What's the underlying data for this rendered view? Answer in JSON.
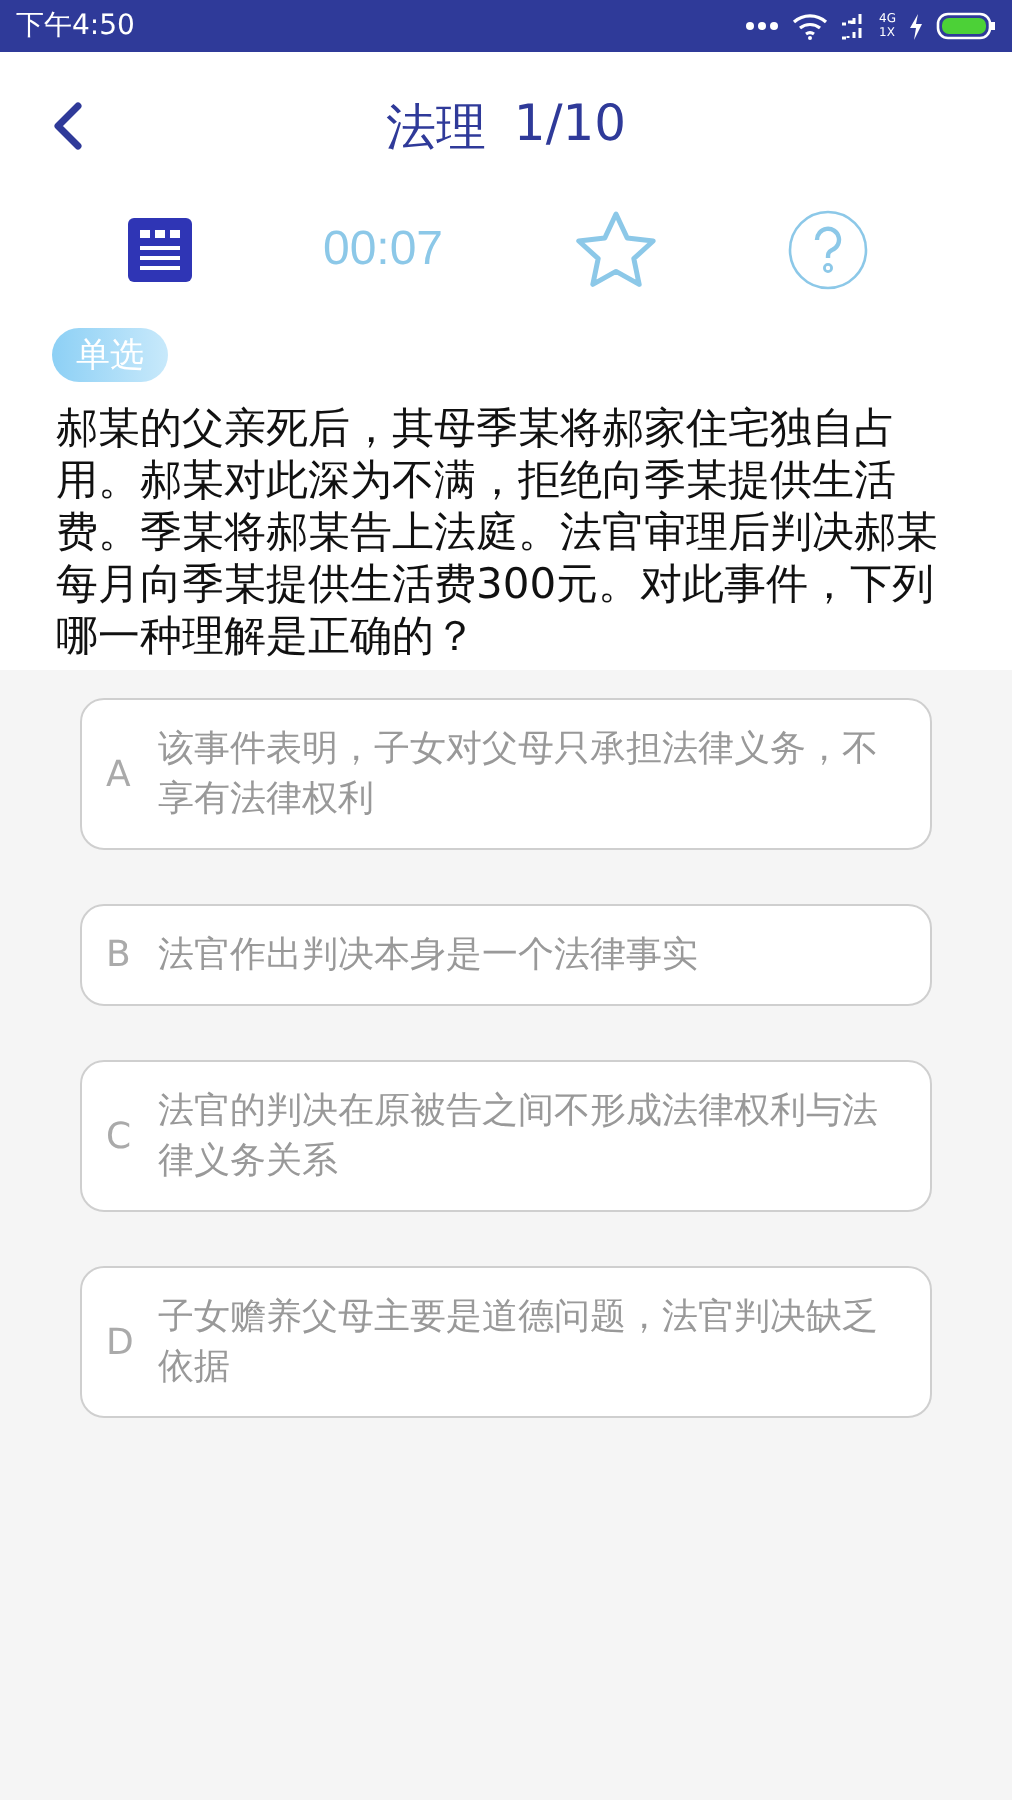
{
  "status_bar": {
    "time": "下午4:50",
    "network_labels": [
      "4G",
      "1X"
    ]
  },
  "header": {
    "title": "法理",
    "progress": "1/10"
  },
  "toolbar": {
    "timer": "00:07",
    "favorited": false
  },
  "question": {
    "type_badge": "单选",
    "text": "郝某的父亲死后，其母季某将郝家住宅独自占用。郝某对此深为不满，拒绝向季某提供生活费。季某将郝某告上法庭。法官审理后判决郝某每月向季某提供生活费300元。对此事件，下列哪一种理解是正确的？"
  },
  "options": [
    {
      "letter": "A",
      "text": "该事件表明，子女对父母只承担法律义务，不享有法律权利"
    },
    {
      "letter": "B",
      "text": "法官作出判决本身是一个法律事实"
    },
    {
      "letter": "C",
      "text": "法官的判决在原被告之间不形成法律权利与法律义务关系"
    },
    {
      "letter": "D",
      "text": "子女赡养父母主要是道德问题，法官判决缺乏依据"
    }
  ]
}
